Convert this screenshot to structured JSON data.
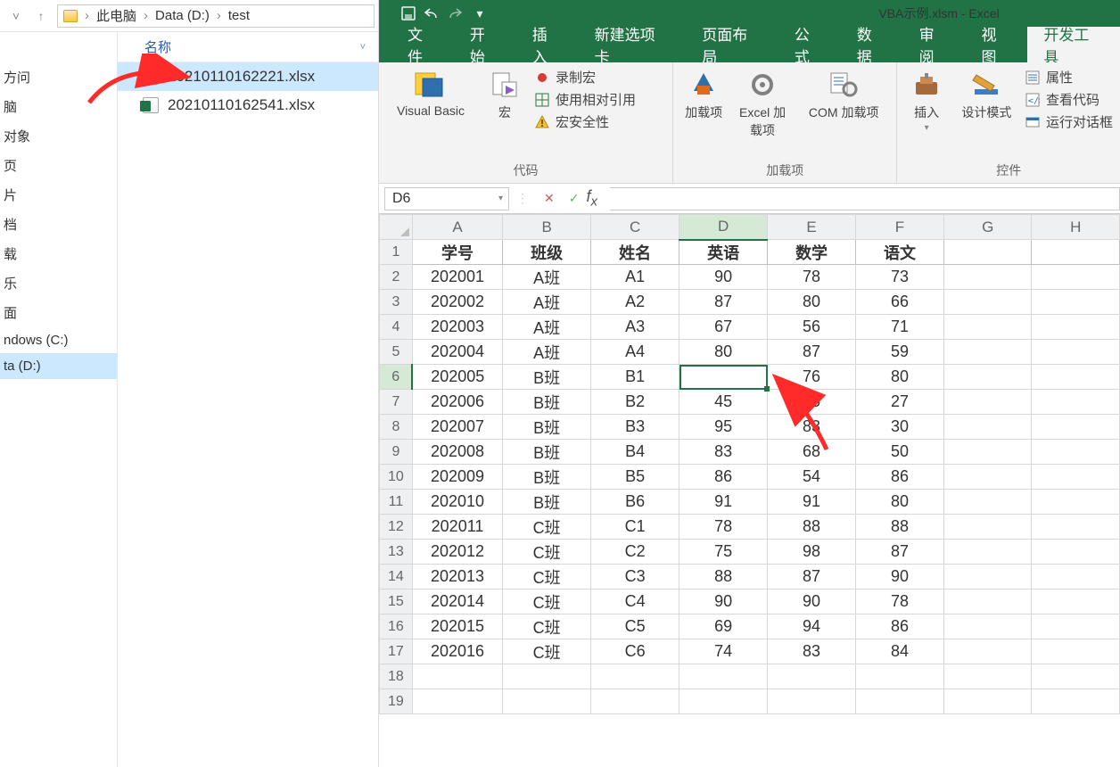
{
  "explorer": {
    "breadcrumbs": [
      "此电脑",
      "Data (D:)",
      "test"
    ],
    "column_header": "名称",
    "files": [
      {
        "name": "20210110162221.xlsx",
        "selected": true
      },
      {
        "name": "20210110162541.xlsx",
        "selected": false
      }
    ],
    "nav_items": [
      {
        "label": "方问"
      },
      {
        "label": "脑"
      },
      {
        "label": "对象"
      },
      {
        "label": "页"
      },
      {
        "label": "片"
      },
      {
        "label": "档"
      },
      {
        "label": "载"
      },
      {
        "label": "乐"
      },
      {
        "label": "面"
      },
      {
        "label": "ndows (C:)"
      },
      {
        "label": "ta (D:)",
        "selected": true
      }
    ]
  },
  "excel": {
    "window_title": "VBA示例.xlsm  -  Excel",
    "tabs": [
      "文件",
      "开始",
      "插入",
      "新建选项卡",
      "页面布局",
      "公式",
      "数据",
      "审阅",
      "视图",
      "开发工具"
    ],
    "active_tab": "开发工具",
    "ribbon": {
      "code_group": {
        "label": "代码",
        "buttons": {
          "visual_basic": "Visual Basic",
          "macro": "宏",
          "record": "录制宏",
          "relative": "使用相对引用",
          "security": "宏安全性"
        }
      },
      "addin_group": {
        "label": "加载项",
        "buttons": {
          "addins": "加载项",
          "excel_addins": "Excel 加载项",
          "com_addins": "COM 加载项"
        }
      },
      "controls_group": {
        "label": "控件",
        "buttons": {
          "insert": "插入",
          "design_mode": "设计模式",
          "properties": "属性",
          "view_code": "查看代码",
          "run_dialog": "运行对话框"
        }
      }
    },
    "name_box": "D6",
    "formula": "",
    "grid": {
      "columns": [
        "A",
        "B",
        "C",
        "D",
        "E",
        "F",
        "G",
        "H"
      ],
      "headers": [
        "学号",
        "班级",
        "姓名",
        "英语",
        "数学",
        "语文"
      ],
      "rows": [
        {
          "r": 2,
          "c": [
            "202001",
            "A班",
            "A1",
            "90",
            "78",
            "73"
          ]
        },
        {
          "r": 3,
          "c": [
            "202002",
            "A班",
            "A2",
            "87",
            "80",
            "66"
          ]
        },
        {
          "r": 4,
          "c": [
            "202003",
            "A班",
            "A3",
            "67",
            "56",
            "71"
          ]
        },
        {
          "r": 5,
          "c": [
            "202004",
            "A班",
            "A4",
            "80",
            "87",
            "59"
          ]
        },
        {
          "r": 6,
          "c": [
            "202005",
            "B班",
            "B1",
            "",
            "76",
            "80"
          ]
        },
        {
          "r": 7,
          "c": [
            "202006",
            "B班",
            "B2",
            "45",
            "85",
            "27"
          ]
        },
        {
          "r": 8,
          "c": [
            "202007",
            "B班",
            "B3",
            "95",
            "83",
            "30"
          ]
        },
        {
          "r": 9,
          "c": [
            "202008",
            "B班",
            "B4",
            "83",
            "68",
            "50"
          ]
        },
        {
          "r": 10,
          "c": [
            "202009",
            "B班",
            "B5",
            "86",
            "54",
            "86"
          ]
        },
        {
          "r": 11,
          "c": [
            "202010",
            "B班",
            "B6",
            "91",
            "91",
            "80"
          ]
        },
        {
          "r": 12,
          "c": [
            "202011",
            "C班",
            "C1",
            "78",
            "88",
            "88"
          ]
        },
        {
          "r": 13,
          "c": [
            "202012",
            "C班",
            "C2",
            "75",
            "98",
            "87"
          ]
        },
        {
          "r": 14,
          "c": [
            "202013",
            "C班",
            "C3",
            "88",
            "87",
            "90"
          ]
        },
        {
          "r": 15,
          "c": [
            "202014",
            "C班",
            "C4",
            "90",
            "90",
            "78"
          ]
        },
        {
          "r": 16,
          "c": [
            "202015",
            "C班",
            "C5",
            "69",
            "94",
            "86"
          ]
        },
        {
          "r": 17,
          "c": [
            "202016",
            "C班",
            "C6",
            "74",
            "83",
            "84"
          ]
        }
      ],
      "empty_rows": [
        18,
        19
      ],
      "selected": {
        "row": 6,
        "col": "D"
      }
    }
  }
}
